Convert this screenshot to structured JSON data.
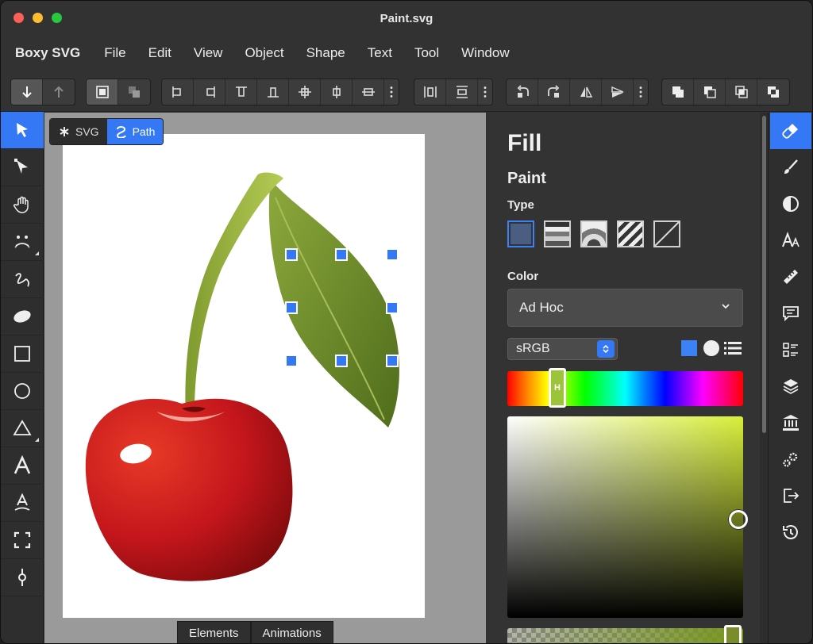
{
  "window": {
    "title": "Paint.svg"
  },
  "menubar": {
    "app_name": "Boxy SVG",
    "items": [
      "File",
      "Edit",
      "View",
      "Object",
      "Shape",
      "Text",
      "Tool",
      "Window"
    ]
  },
  "breadcrumb": {
    "svg_label": "SVG",
    "path_label": "Path"
  },
  "bottom_tabs": [
    "Elements",
    "Animations"
  ],
  "fill_panel": {
    "heading": "Fill",
    "paint_heading": "Paint",
    "type_label": "Type",
    "color_label": "Color",
    "color_value": "Ad Hoc",
    "color_space": "sRGB",
    "hue_handle_letter": "H",
    "accent_color": "#3478f6"
  },
  "icons": {
    "left_tools": [
      "select-icon",
      "edit-nodes-icon",
      "pan-hand-icon",
      "face-icon",
      "freehand-icon",
      "ellipse-shape-icon",
      "rectangle-icon",
      "circle-icon",
      "triangle-icon",
      "text-icon",
      "text-on-path-icon",
      "crop-icon",
      "pin-icon"
    ],
    "right_panels": [
      "fill-icon",
      "stroke-brush-icon",
      "contrast-icon",
      "typography-icon",
      "ruler-icon",
      "comment-icon",
      "list-icon",
      "layers-icon",
      "library-icon",
      "gears-icon",
      "export-icon",
      "history-icon"
    ]
  }
}
